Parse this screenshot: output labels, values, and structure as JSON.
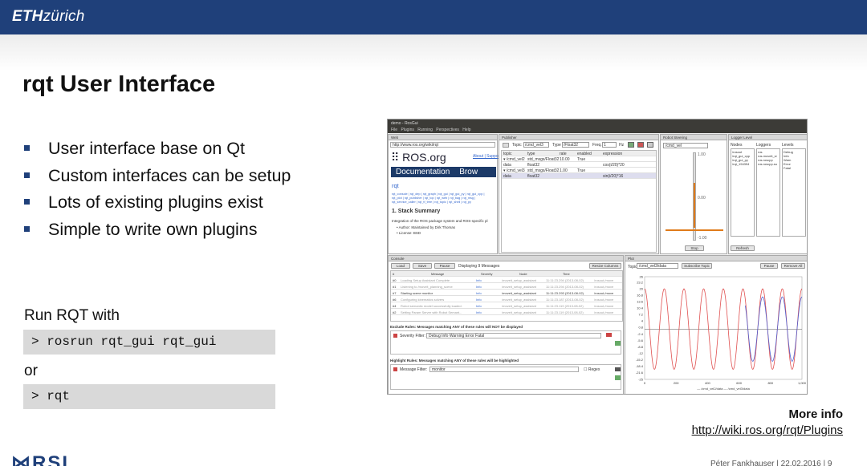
{
  "header": {
    "brand_bold": "ETH",
    "brand_rest": "zürich"
  },
  "slide": {
    "title": "rqt User Interface",
    "bullets": [
      "User interface base on Qt",
      "Custom interfaces can be setup",
      "Lots of existing plugins exist",
      "Simple to write own plugins"
    ],
    "run_label": "Run RQT with",
    "code1": "> rosrun rqt_gui rqt_gui",
    "or_label": "or",
    "code2": "> rqt",
    "more_info": "More info",
    "link": "http://wiki.ros.org/rqt/Plugins",
    "footer": "Péter Fankhauser  |  22.02.2016  |  9",
    "logo": "RSL"
  },
  "shot": {
    "window_title": "demo - RosGui",
    "menu": [
      "File",
      "Plugins",
      "Running",
      "Perspectives",
      "Help"
    ],
    "web": {
      "title": "Web",
      "url": "http://www.ros.org/wiki/rqt",
      "site": "ROS.org",
      "about": "About | Suppo",
      "nav1": "Documentation",
      "nav2": "Brow",
      "heading": "rqt",
      "links1": "rqt_console | rqt_dep | rqt_graph | rqt_gui | rqt_gui_py | rqt_gui_cpp |",
      "links2": "rqt_plot | rqt_publisher | rqt_top | rqt_web | rqt_bag | rqt_msg |",
      "links3": "rqt_service_caller | rqt_tf_tree | rqt_topic | rqt_shell | rqt_py",
      "section": "1. Stack Summary",
      "summary": "Integration of the ROS package system and ROS-specific pl",
      "author": "• Author: Maintained by Dirk Thomas",
      "license": "• License: BSD"
    },
    "publisher": {
      "title": "Publisher",
      "topic_lbl": "Topic",
      "topic": "/cmd_vel3",
      "type_lbl": "Type",
      "type": "/Float32",
      "freq_lbl": "Freq.",
      "freq": "1",
      "hz": "Hz",
      "cols": [
        "topic",
        "type",
        "rate",
        "enabled",
        "expression"
      ],
      "rows": [
        [
          "▾ /cmd_vel2",
          "std_msgs/Float32",
          "10.00",
          "True",
          ""
        ],
        [
          "   data",
          "float32",
          "",
          "",
          "cos(i/20)*20"
        ],
        [
          "▾ /cmd_vel3",
          "std_msgs/Float32",
          "1.00",
          "True",
          ""
        ],
        [
          "   data",
          "float32",
          "",
          "",
          "sin(i/20)*16"
        ]
      ]
    },
    "steering": {
      "title": "Robot Steering",
      "topic": "/cmd_vel",
      "stop": "Stop",
      "ticks": [
        "1.00",
        "0.00",
        "-1.00"
      ],
      "lr": [
        "3.00",
        "",
        "0.00"
      ]
    },
    "logger": {
      "title": "Logger Level",
      "nodes_lbl": "Nodes",
      "loggers_lbl": "Loggers",
      "levels_lbl": "Levels",
      "nodes": [
        "/rosout",
        "/rqt_gui_cpp",
        "/rqt_gui_py",
        "/rqt_194394"
      ],
      "loggers": [
        "ros",
        "ros.moveit_si",
        "ros.roscpp",
        "ros.roscpp.su"
      ],
      "levels": [
        "Debug",
        "Info",
        "Warn",
        "Error",
        "Fatal"
      ],
      "refresh": "Refresh"
    },
    "console": {
      "title": "Console",
      "load": "Load",
      "save": "Save",
      "pause": "Pause",
      "displaying": "Displaying 9 Messages",
      "resize": "Resize Columns",
      "cols": [
        "#",
        "Message",
        "Severity",
        "Node",
        "Time",
        ""
      ],
      "rows": [
        [
          "#0",
          "Loading Setup Assistant Complete",
          "Info",
          "/moveit_setup_assistant",
          "11:11:23.294 (2013-08-02)",
          "/rosout,/move"
        ],
        [
          "#1",
          "Listening to /moveit_planning_scene",
          "Info",
          "/moveit_setup_assistant",
          "11:11:23.294 (2013-08-02)",
          "/rosout,/move"
        ],
        [
          "#7",
          "Starting scene monitor",
          "Info",
          "/moveit_setup_assistant",
          "11:11:23.293 (2013-08-02)",
          "/rosout,/move"
        ],
        [
          "#6",
          "Configuring kinematics solvers",
          "Info",
          "/moveit_setup_assistant",
          "11:11:23.187 (2013-08-02)",
          "/rosout,/move"
        ],
        [
          "#4",
          "Robot semantic model successfully loaded.",
          "Info",
          "/moveit_setup_assistant",
          "11:11:23.119 (2013-08-02)",
          "/rosout,/move"
        ],
        [
          "#2",
          "Setting Param Server with Robot Semant...",
          "Info",
          "/moveit_setup_assistant",
          "11:11:23.119 (2013-08-02)",
          "/rosout,/move"
        ]
      ],
      "exclude_lbl": "Exclude Rules: Messages matching ANY of these rules will NOT be displayed",
      "sev_filter_lbl": "Severity Filter:",
      "sev_levels": "Debug  Info  Warning  Error  Fatal",
      "highlight_lbl": "Highlight Rules: Messages matching ANY of these rules will be highlighted",
      "msg_filter_lbl": "Message Filter:",
      "msg_filter": "monitor",
      "regex": "Regex"
    },
    "plot": {
      "title": "Plot",
      "topic_lbl": "Topic",
      "topic": "/cmd_vel3/data",
      "subscribe": "Subscribe Topic",
      "pause": "Pause",
      "remove_all": "Remove All",
      "legend": "— /cmd_vel2/data  — /cmd_vel3/data",
      "yticks": [
        "26",
        "23.2",
        "20",
        "16.8",
        "13.6",
        "10.4",
        "7.2",
        "4",
        "0.8",
        "-2.4",
        "-5.6",
        "-8.8",
        "-12",
        "-15.2",
        "-18.4",
        "-21.6",
        "-25"
      ],
      "xticks": [
        "0",
        "200",
        "400",
        "600",
        "800",
        "1,000"
      ]
    }
  },
  "chart_data": {
    "type": "line",
    "x_range": [
      0,
      1000
    ],
    "ylim": [
      -25,
      26
    ],
    "x_ticks": [
      0,
      200,
      400,
      600,
      800,
      1000
    ],
    "y_ticks": [
      26,
      23.2,
      20,
      16.8,
      13.6,
      10.4,
      7.2,
      4,
      0.8,
      -2.4,
      -5.6,
      -8.8,
      -12,
      -15.2,
      -18.4,
      -21.6,
      -25
    ],
    "series": [
      {
        "name": "/cmd_vel2/data",
        "color": "#e05050",
        "amplitude": 20,
        "period": 125,
        "x_start": 0,
        "x_end": 1000
      },
      {
        "name": "/cmd_vel3/data",
        "color": "#5060d0",
        "amplitude": 16,
        "period": 125,
        "x_start": 640,
        "x_end": 1000
      }
    ]
  },
  "colors": {
    "brand": "#1f407a",
    "code_bg": "#d9d9d9",
    "bullet": "#1f407a"
  }
}
